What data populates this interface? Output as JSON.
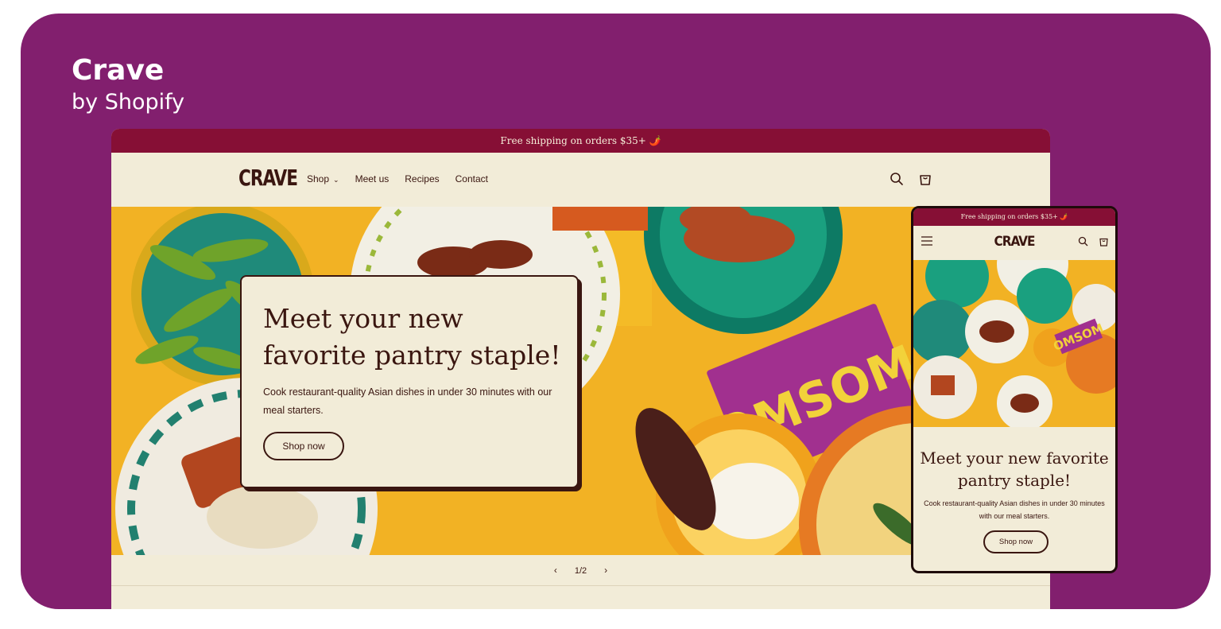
{
  "theme": {
    "name": "Crave",
    "byline": "by Shopify"
  },
  "colors": {
    "background": "#821f6e",
    "announcement": "#860f35",
    "cream": "#f2ecd8",
    "brown": "#3a1610",
    "food_yellow": "#f4b51f"
  },
  "desktop": {
    "announcement": "Free shipping on orders $35+ 🌶️",
    "logo": "CRAVE",
    "nav": [
      {
        "label": "Shop",
        "has_dropdown": true
      },
      {
        "label": "Meet us"
      },
      {
        "label": "Recipes"
      },
      {
        "label": "Contact"
      }
    ],
    "icons": [
      "search-icon",
      "cart-icon"
    ],
    "hero": {
      "heading": "Meet your new favorite pantry staple!",
      "text": "Cook restaurant-quality Asian dishes in under 30 minutes with our meal starters.",
      "button": "Shop now",
      "package_text": "OMSOM"
    },
    "pager": {
      "current": 1,
      "total": 2,
      "label": "1/2"
    }
  },
  "mobile": {
    "announcement": "Free shipping on orders $35+ 🌶️",
    "logo": "CRAVE",
    "icons": [
      "menu-icon",
      "search-icon",
      "cart-icon"
    ],
    "hero": {
      "heading": "Meet your new favorite pantry staple!",
      "text": "Cook restaurant-quality Asian dishes in under 30 minutes with our meal starters.",
      "button": "Shop now",
      "package_text": "OMSOM"
    }
  }
}
